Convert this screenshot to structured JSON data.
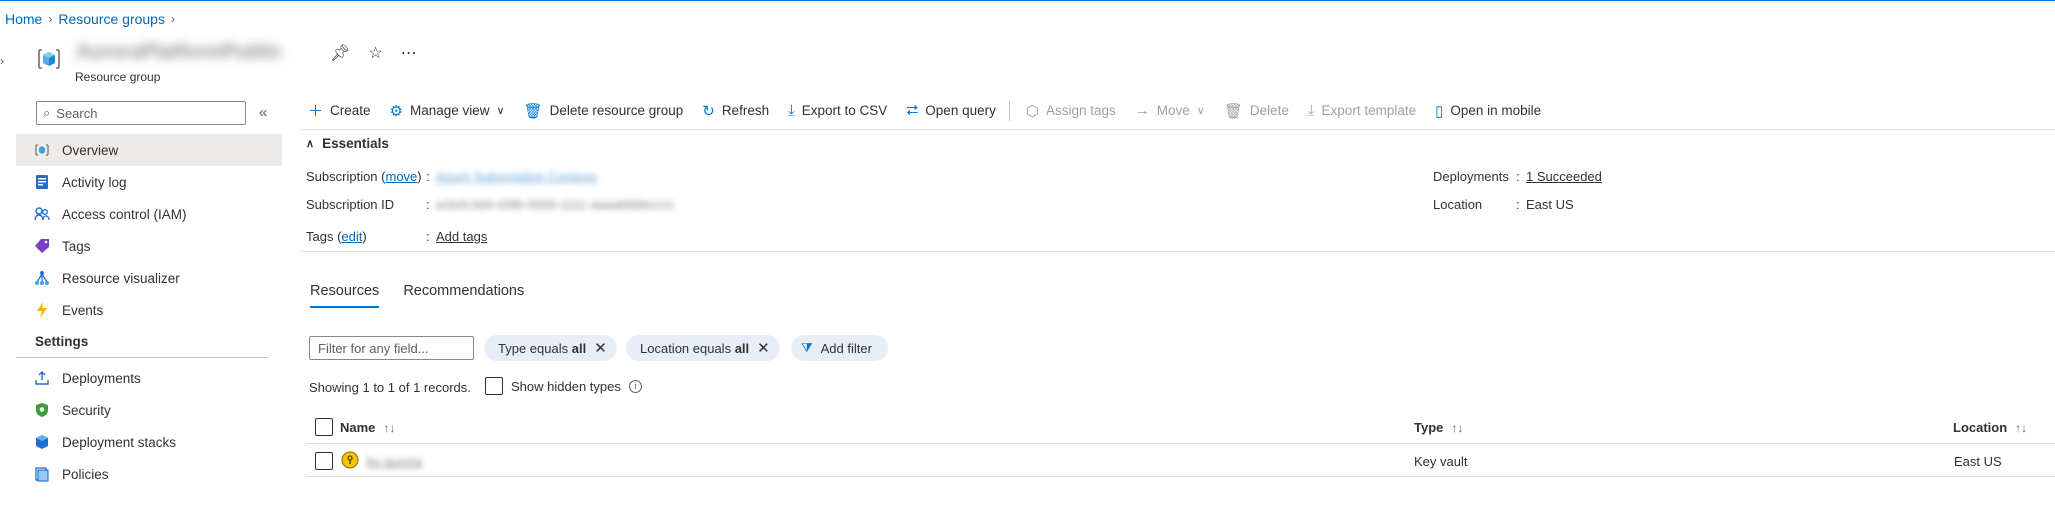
{
  "breadcrumb": {
    "home": "Home",
    "resource_groups": "Resource groups"
  },
  "resource_group": {
    "name": "AuroraPlatformPublic",
    "subtitle": "Resource group"
  },
  "sidebar": {
    "search_placeholder": "Search",
    "items": [
      {
        "label": "Overview",
        "icon": "overview-icon"
      },
      {
        "label": "Activity log",
        "icon": "activity-log-icon"
      },
      {
        "label": "Access control (IAM)",
        "icon": "iam-icon"
      },
      {
        "label": "Tags",
        "icon": "tag-icon"
      },
      {
        "label": "Resource visualizer",
        "icon": "visualizer-icon"
      },
      {
        "label": "Events",
        "icon": "events-icon"
      }
    ],
    "settings_header": "Settings",
    "settings_items": [
      {
        "label": "Deployments",
        "icon": "deployments-icon"
      },
      {
        "label": "Security",
        "icon": "security-icon"
      },
      {
        "label": "Deployment stacks",
        "icon": "deployment-stacks-icon"
      },
      {
        "label": "Policies",
        "icon": "policies-icon"
      }
    ]
  },
  "toolbar": {
    "create": "Create",
    "manage_view": "Manage view",
    "delete_rg": "Delete resource group",
    "refresh": "Refresh",
    "export_csv": "Export to CSV",
    "open_query": "Open query",
    "assign_tags": "Assign tags",
    "move": "Move",
    "delete": "Delete",
    "export_template": "Export template",
    "open_mobile": "Open in mobile"
  },
  "essentials": {
    "header": "Essentials",
    "subscription_label_pre": "Subscription (",
    "subscription_move": "move",
    "subscription_label_post": ")",
    "subscription_value": "Azure Subscription Contoso",
    "subscription_id_label": "Subscription ID",
    "subscription_id_value": "a1b2c3d4-e5f6-0000-1111-aaaabbbbcccc",
    "tags_label_pre": "Tags (",
    "tags_edit": "edit",
    "tags_label_post": ")",
    "tags_value": "Add tags",
    "deployments_label": "Deployments",
    "deployments_value": "1 Succeeded",
    "location_label": "Location",
    "location_value": "East US",
    "colon": ":"
  },
  "tabs": {
    "resources": "Resources",
    "recommendations": "Recommendations"
  },
  "filters": {
    "placeholder": "Filter for any field...",
    "type_pre": "Type equals",
    "type_val": "all",
    "location_pre": "Location equals",
    "location_val": "all",
    "add_filter": "Add filter"
  },
  "records": {
    "text": "Showing 1 to 1 of 1 records.",
    "show_hidden": "Show hidden types"
  },
  "table": {
    "headers": {
      "name": "Name",
      "type": "Type",
      "location": "Location"
    },
    "rows": [
      {
        "name": "kv-aurora",
        "type": "Key vault",
        "location": "East US"
      }
    ]
  }
}
